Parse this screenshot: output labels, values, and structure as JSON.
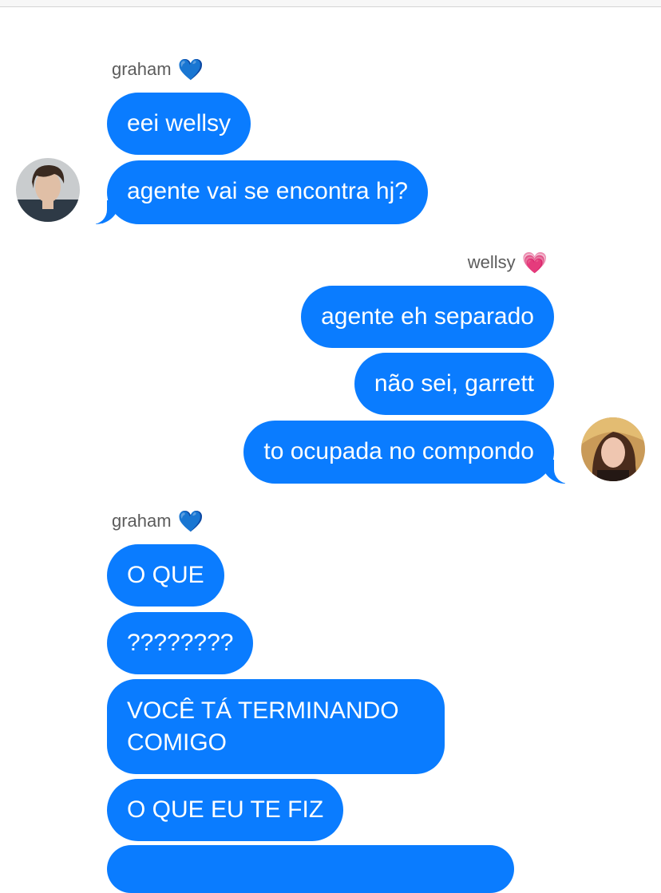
{
  "thread": {
    "groups": [
      {
        "sender": "graham",
        "heart": "💙",
        "messages": [
          "eei wellsy",
          "agente vai se encontra hj?"
        ]
      },
      {
        "sender": "wellsy",
        "heart": "💗",
        "messages": [
          "agente eh separado",
          "não sei, garrett",
          "to ocupada no compondo"
        ]
      },
      {
        "sender": "graham",
        "heart": "💙",
        "messages": [
          "O QUE",
          "????????",
          "VOCÊ TÁ TERMINANDO COMIGO",
          "O QUE EU TE FIZ"
        ]
      }
    ]
  },
  "colors": {
    "bubble": "#0a7cff",
    "bubble_text": "#ffffff",
    "sender_label": "#5c5c5c",
    "background": "#ffffff"
  },
  "icons": {
    "graham_avatar": "avatar-photo-man",
    "wellsy_avatar": "avatar-photo-woman"
  }
}
